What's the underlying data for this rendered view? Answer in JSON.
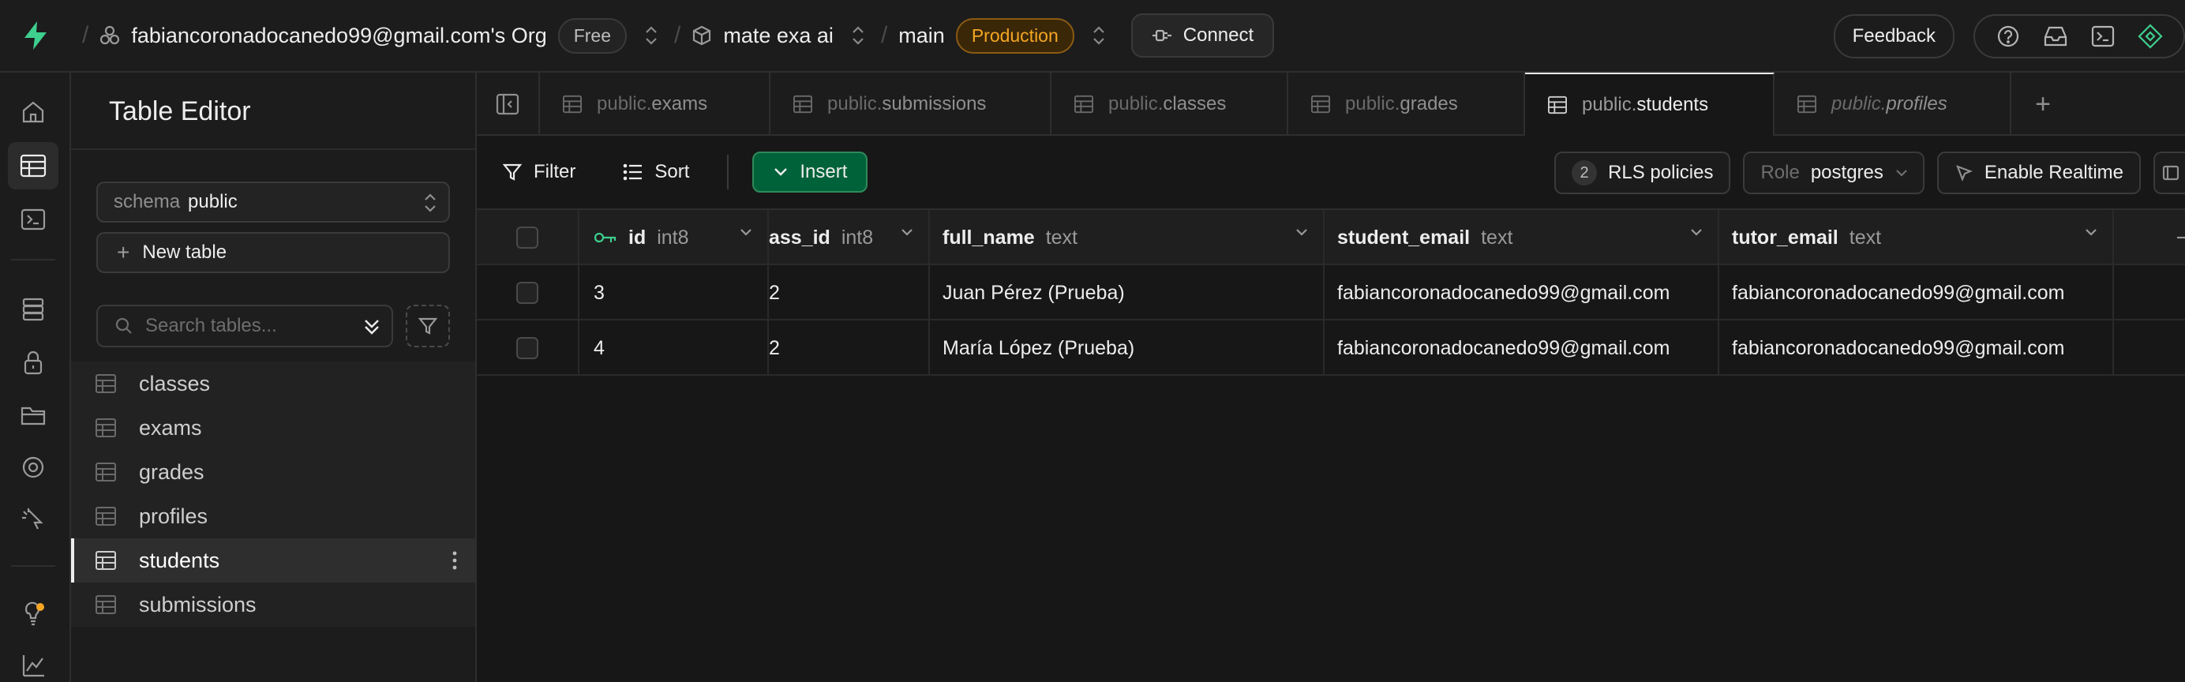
{
  "topbar": {
    "org_name": "fabiancoronadocanedo99@gmail.com's Org",
    "org_plan": "Free",
    "project_name": "mate exa ai",
    "branch_name": "main",
    "branch_env": "Production",
    "connect_label": "Connect",
    "feedback_label": "Feedback"
  },
  "sidebar": {
    "title": "Table Editor",
    "schema_label": "schema",
    "schema_value": "public",
    "new_table_label": "New table",
    "search_placeholder": "Search tables...",
    "tables": [
      "classes",
      "exams",
      "grades",
      "profiles",
      "students",
      "submissions"
    ],
    "active_table": "students"
  },
  "tabs": [
    {
      "schema": "public.",
      "name": "exams"
    },
    {
      "schema": "public.",
      "name": "submissions"
    },
    {
      "schema": "public.",
      "name": "classes"
    },
    {
      "schema": "public.",
      "name": "grades"
    },
    {
      "schema": "public.",
      "name": "students"
    },
    {
      "schema": "public.",
      "name": "profiles"
    }
  ],
  "toolbar": {
    "filter_label": "Filter",
    "sort_label": "Sort",
    "insert_label": "Insert",
    "rls_count": "2",
    "rls_label": "RLS policies",
    "role_label": "Role",
    "role_value": "postgres",
    "realtime_label": "Enable Realtime"
  },
  "grid": {
    "columns": [
      {
        "name": "id",
        "type": "int8"
      },
      {
        "name": "ass_id",
        "type": "int8"
      },
      {
        "name": "full_name",
        "type": "text"
      },
      {
        "name": "student_email",
        "type": "text"
      },
      {
        "name": "tutor_email",
        "type": "text"
      }
    ],
    "rows": [
      [
        "3",
        "2",
        "Juan Pérez (Prueba)",
        "fabiancoronadocanedo99@gmail.com",
        "fabiancoronadocanedo99@gmail.com"
      ],
      [
        "4",
        "2",
        "María López (Prueba)",
        "fabiancoronadocanedo99@gmail.com",
        "fabiancoronadocanedo99@gmail.com"
      ]
    ]
  },
  "colors": {
    "brand_green": "#3ecf8e",
    "insert_green": "#006239",
    "production_orange": "#f5a623"
  }
}
